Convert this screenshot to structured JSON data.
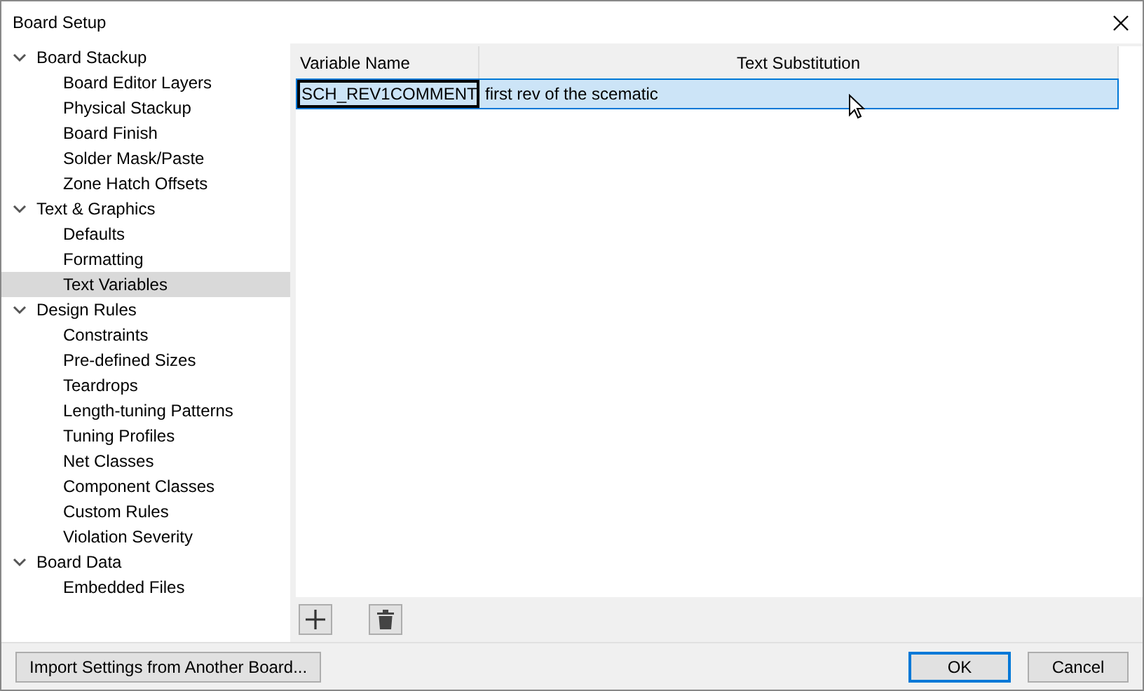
{
  "window": {
    "title": "Board Setup"
  },
  "tree": [
    {
      "label": "Board Stackup",
      "expanded": true,
      "selected": false,
      "children": [
        {
          "label": "Board Editor Layers",
          "selected": false
        },
        {
          "label": "Physical Stackup",
          "selected": false
        },
        {
          "label": "Board Finish",
          "selected": false
        },
        {
          "label": "Solder Mask/Paste",
          "selected": false
        },
        {
          "label": "Zone Hatch Offsets",
          "selected": false
        }
      ]
    },
    {
      "label": "Text & Graphics",
      "expanded": true,
      "selected": false,
      "children": [
        {
          "label": "Defaults",
          "selected": false
        },
        {
          "label": "Formatting",
          "selected": false
        },
        {
          "label": "Text Variables",
          "selected": true
        }
      ]
    },
    {
      "label": "Design Rules",
      "expanded": true,
      "selected": false,
      "children": [
        {
          "label": "Constraints",
          "selected": false
        },
        {
          "label": "Pre-defined Sizes",
          "selected": false
        },
        {
          "label": "Teardrops",
          "selected": false
        },
        {
          "label": "Length-tuning Patterns",
          "selected": false
        },
        {
          "label": "Tuning Profiles",
          "selected": false
        },
        {
          "label": "Net Classes",
          "selected": false
        },
        {
          "label": "Component Classes",
          "selected": false
        },
        {
          "label": "Custom Rules",
          "selected": false
        },
        {
          "label": "Violation Severity",
          "selected": false
        }
      ]
    },
    {
      "label": "Board Data",
      "expanded": true,
      "selected": false,
      "children": [
        {
          "label": "Embedded Files",
          "selected": false
        }
      ]
    }
  ],
  "table": {
    "columns": [
      "Variable Name",
      "Text Substitution"
    ],
    "rows": [
      {
        "cells": [
          "SCH_REV1COMMENT",
          "first rev of the scematic"
        ],
        "selected": true
      }
    ]
  },
  "buttons": {
    "import": "Import Settings from Another Board...",
    "ok": "OK",
    "cancel": "Cancel"
  }
}
